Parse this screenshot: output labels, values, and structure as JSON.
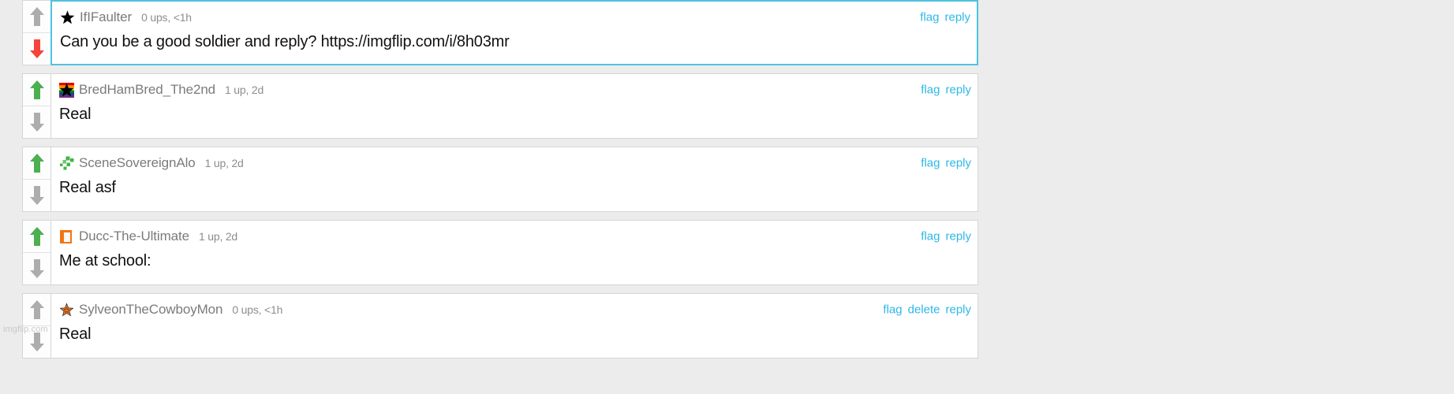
{
  "site": {
    "watermark": "imgflip.com",
    "accent_link_color": "#2eb8e6",
    "highlight_border_color": "#4ec3e0",
    "upvote_active_color": "#4caf50",
    "downvote_active_color": "#f4443b",
    "arrow_inactive_color": "#adadad"
  },
  "comments": [
    {
      "username": "IfIFaulter",
      "stats": "0 ups, <1h",
      "text": "Can you be a good soldier and reply? https://imgflip.com/i/8h03mr",
      "avatar": "black-star-icon",
      "highlighted": true,
      "upvote_state": "inactive",
      "downvote_state": "active",
      "actions": [
        "flag",
        "reply"
      ]
    },
    {
      "username": "BredHamBred_The2nd",
      "stats": "1 up, 2d",
      "text": "Real",
      "avatar": "rainbow-star-icon",
      "highlighted": false,
      "upvote_state": "active",
      "downvote_state": "inactive",
      "actions": [
        "flag",
        "reply"
      ]
    },
    {
      "username": "SceneSovereignAlo",
      "stats": "1 up, 2d",
      "text": "Real asf",
      "avatar": "green-pixels-icon",
      "highlighted": false,
      "upvote_state": "active",
      "downvote_state": "inactive",
      "actions": [
        "flag",
        "reply"
      ]
    },
    {
      "username": "Ducc-The-Ultimate",
      "stats": "1 up, 2d",
      "text": "Me at school:",
      "avatar": "orange-frame-icon",
      "highlighted": false,
      "upvote_state": "active",
      "downvote_state": "inactive",
      "actions": [
        "flag",
        "reply"
      ]
    },
    {
      "username": "SylveonTheCowboyMon",
      "stats": "0 ups, <1h",
      "text": "Real",
      "avatar": "sheriff-star-icon",
      "highlighted": false,
      "upvote_state": "inactive",
      "downvote_state": "inactive",
      "actions": [
        "flag",
        "delete",
        "reply"
      ]
    }
  ]
}
